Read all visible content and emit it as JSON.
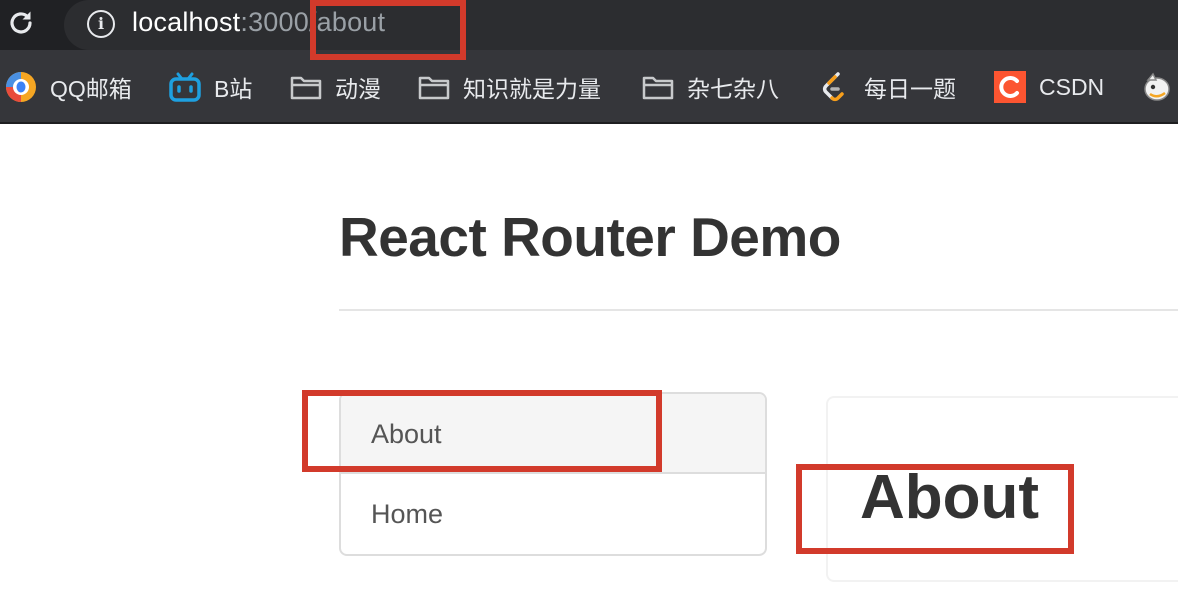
{
  "browser": {
    "url": {
      "host": "localhost",
      "rest": ":3000/about"
    },
    "bookmarks": [
      {
        "label": "QQ邮箱",
        "icon": "qq-mail-icon"
      },
      {
        "label": "B站",
        "icon": "bilibili-icon"
      },
      {
        "label": "动漫",
        "icon": "folder-icon"
      },
      {
        "label": "知识就是力量",
        "icon": "folder-icon"
      },
      {
        "label": "杂七杂八",
        "icon": "folder-icon"
      },
      {
        "label": "每日一题",
        "icon": "leetcode-icon"
      },
      {
        "label": "CSDN",
        "icon": "csdn-icon"
      },
      {
        "label": "",
        "icon": "mascot-icon"
      }
    ]
  },
  "page": {
    "title": "React Router Demo",
    "nav": [
      {
        "label": "About",
        "active": true
      },
      {
        "label": "Home",
        "active": false
      }
    ],
    "content_heading": "About"
  },
  "colors": {
    "annotation_red": "#d23a2b",
    "chrome_dark": "#202124",
    "bookmark_bar": "#35363a"
  }
}
